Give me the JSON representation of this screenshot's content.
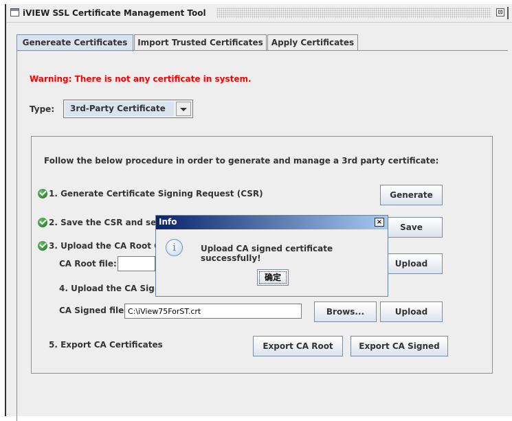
{
  "window": {
    "title": "iVIEW SSL Certificate Management Tool",
    "maximize_glyph": "⊡"
  },
  "tabs": [
    {
      "label": "Genereate Certificates",
      "active": true
    },
    {
      "label": "Import Trusted Certificates",
      "active": false
    },
    {
      "label": "Apply Certificates",
      "active": false
    }
  ],
  "warning": "Warning: There is not any certificate in system.",
  "type_label": "Type:",
  "type_value": "3rd-Party Certificate",
  "procedure": {
    "intro": "Follow the below procedure in order to generate and manage a 3rd party certificate:",
    "step1": {
      "label": "1. Generate Certificate Signing Request (CSR)",
      "button": "Generate"
    },
    "step2": {
      "label": "2. Save the CSR and sen",
      "button": "Save"
    },
    "step3": {
      "label": "3. Upload the CA Root Ce",
      "field_label": "CA Root file:",
      "field_value": "",
      "button": "Upload"
    },
    "step4": {
      "label": "4. Upload the CA Signed (",
      "field_label": "CA Signed file:",
      "field_value": "C:\\iView75ForST.crt",
      "browse_button": "Brows...",
      "button": "Upload"
    },
    "step5": {
      "label": "5. Export CA Certificates",
      "export_root": "Export CA Root",
      "export_signed": "Export CA Signed"
    }
  },
  "dialog": {
    "title": "Info",
    "close_glyph": "×",
    "icon_glyph": "i",
    "message": "Upload CA signed certificate successfully!",
    "ok": "确定"
  },
  "colors": {
    "warning": "#ff0000",
    "dialog_title_start": "#0a246a",
    "dialog_title_end": "#a6caf0",
    "active_tab": "#dbe3ef",
    "check": "#2e8b2e"
  }
}
